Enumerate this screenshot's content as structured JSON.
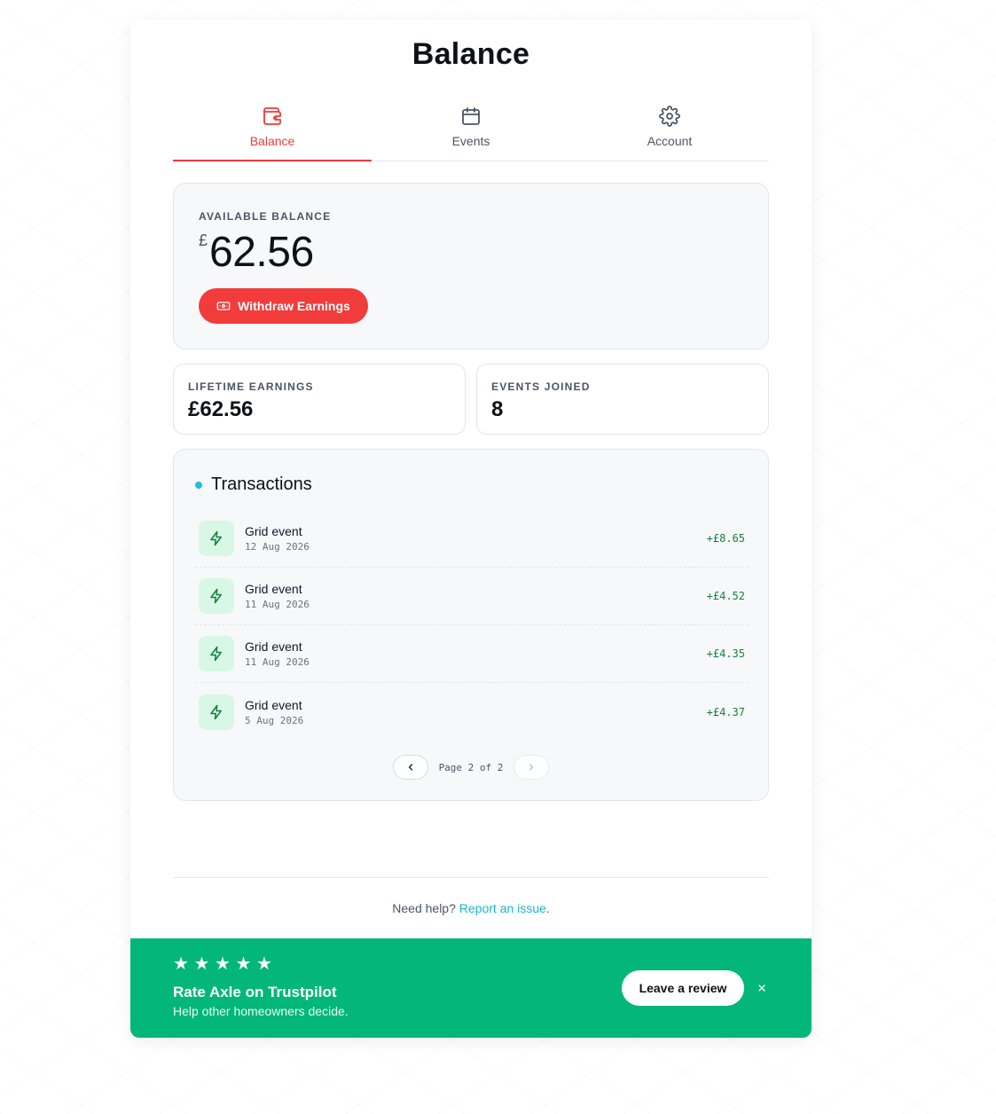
{
  "page": {
    "title": "Balance"
  },
  "tabs": [
    {
      "label": "Balance",
      "icon": "wallet-icon",
      "active": true
    },
    {
      "label": "Events",
      "icon": "calendar-icon",
      "active": false
    },
    {
      "label": "Account",
      "icon": "gear-icon",
      "active": false
    }
  ],
  "balance": {
    "label": "AVAILABLE BALANCE",
    "currency": "£",
    "value": "62.56",
    "withdraw_label": "Withdraw Earnings"
  },
  "stats": {
    "lifetime_label": "LIFETIME EARNINGS",
    "lifetime_value": "£62.56",
    "events_label": "EVENTS JOINED",
    "events_value": "8"
  },
  "transactions": {
    "title": "Transactions",
    "items": [
      {
        "name": "Grid event",
        "date": "12 Aug 2026",
        "amount": "+£8.65"
      },
      {
        "name": "Grid event",
        "date": "11 Aug 2026",
        "amount": "+£4.52"
      },
      {
        "name": "Grid event",
        "date": "11 Aug 2026",
        "amount": "+£4.35"
      },
      {
        "name": "Grid event",
        "date": "5 Aug 2026",
        "amount": "+£4.37"
      }
    ],
    "pager_text": "Page 2 of 2"
  },
  "help": {
    "text": "Need help?",
    "link": "Report an issue",
    "suffix": "."
  },
  "banner": {
    "stars": "★ ★ ★ ★ ★",
    "title": "Rate Axle on Trustpilot",
    "subtitle": "Help other homeowners decide.",
    "button_label": "Leave a review"
  },
  "colors": {
    "accent": "#ef3b3b",
    "positive": "#16803f",
    "banner": "#03b67a",
    "link": "#18b4d3"
  }
}
